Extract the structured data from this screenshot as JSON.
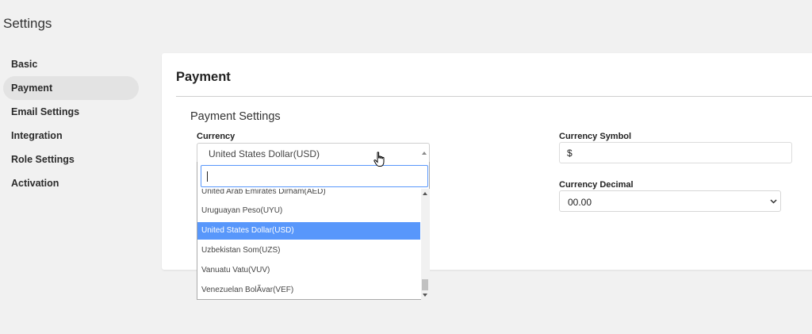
{
  "page": {
    "title": "Settings"
  },
  "sidebar": {
    "items": [
      {
        "label": "Basic"
      },
      {
        "label": "Payment"
      },
      {
        "label": "Email Settings"
      },
      {
        "label": "Integration"
      },
      {
        "label": "Role Settings"
      },
      {
        "label": "Activation"
      }
    ],
    "active": "Payment"
  },
  "card": {
    "title": "Payment"
  },
  "payment_settings": {
    "title": "Payment Settings",
    "currency": {
      "label": "Currency",
      "value": "United States Dollar(USD)"
    },
    "currency_symbol": {
      "label": "Currency Symbol",
      "value": "$"
    },
    "currency_decimal": {
      "label": "Currency Decimal",
      "value": "00.00"
    }
  },
  "currency_dropdown": {
    "search_value": "",
    "options": [
      "United Arab Emirates Dirham(AED)",
      "Uruguayan Peso(UYU)",
      "United States Dollar(USD)",
      "Uzbekistan Som(UZS)",
      "Vanuatu Vatu(VUV)",
      "Venezuelan BolÃ­var(VEF)"
    ],
    "selected": "United States Dollar(USD)"
  },
  "colors": {
    "highlight": "#5897fb",
    "background": "#f1f1f1",
    "card": "#ffffff",
    "sidebar_active": "#e3e3e3"
  }
}
